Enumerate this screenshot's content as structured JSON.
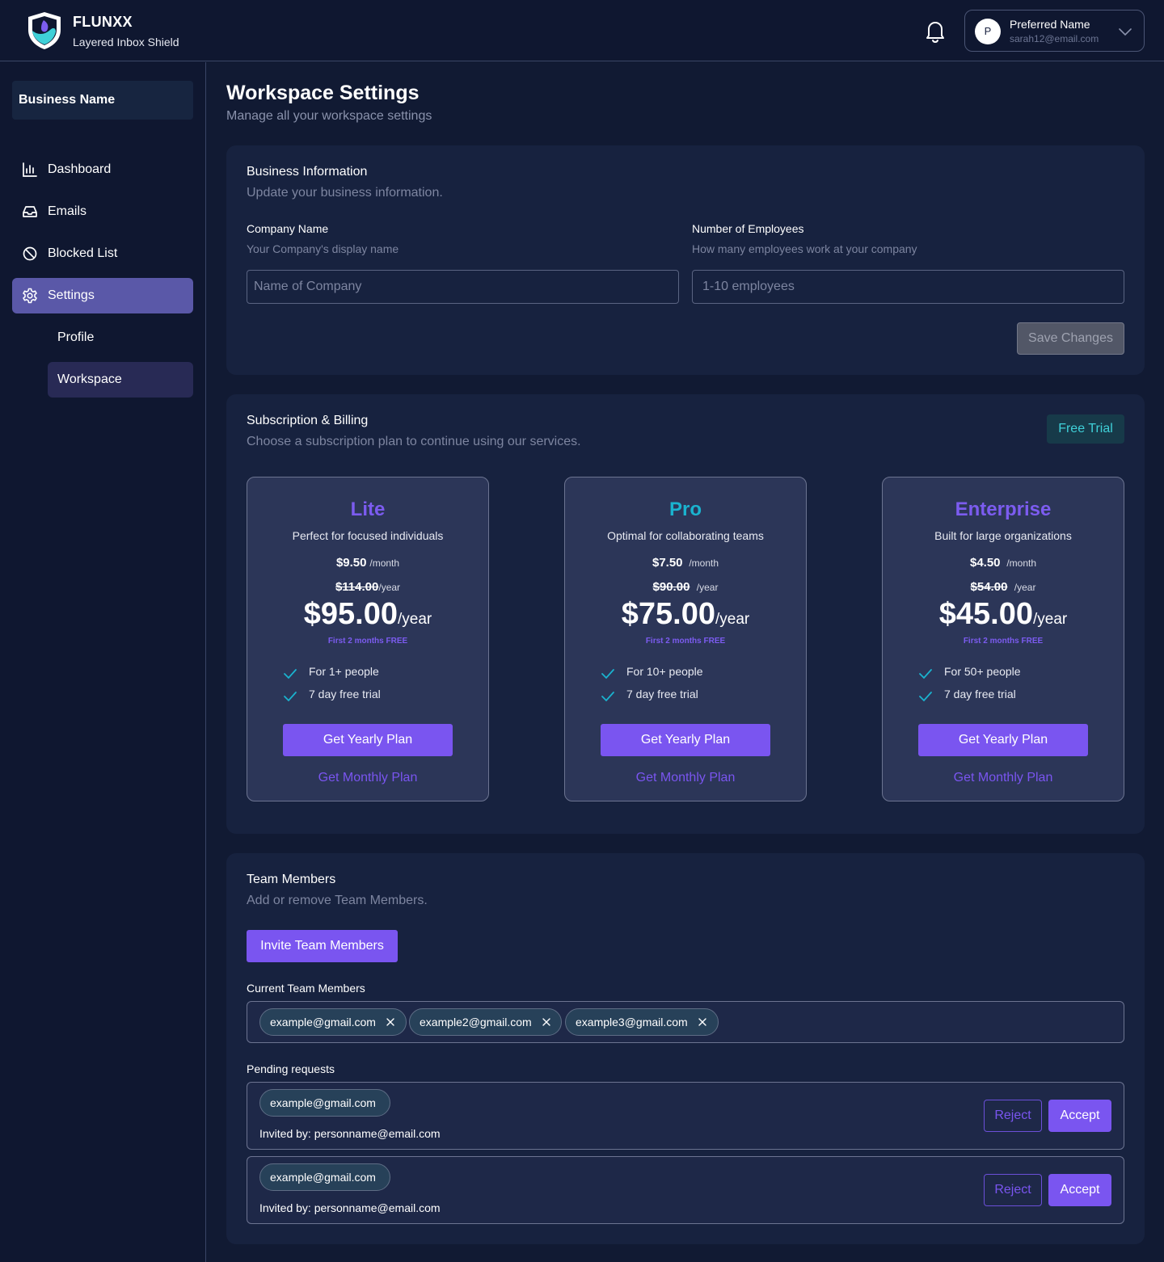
{
  "brand": {
    "name": "FLUNXX",
    "tagline": "Layered Inbox Shield"
  },
  "user": {
    "initial": "P",
    "name": "Preferred Name",
    "email": "sarah12@email.com"
  },
  "sidebar": {
    "business": "Business Name",
    "items": [
      {
        "label": "Dashboard",
        "icon": "bar-chart-icon"
      },
      {
        "label": "Emails",
        "icon": "inbox-icon"
      },
      {
        "label": "Blocked List",
        "icon": "blocked-icon"
      },
      {
        "label": "Settings",
        "icon": "gear-icon"
      }
    ],
    "sub_items": [
      {
        "label": "Profile"
      },
      {
        "label": "Workspace"
      }
    ]
  },
  "page": {
    "title": "Workspace Settings",
    "subtitle": "Manage all your workspace settings"
  },
  "business_info": {
    "title": "Business Information",
    "subtitle": "Update your business information.",
    "company_label": "Company Name",
    "company_help": "Your Company's display name",
    "company_placeholder": "Name of Company",
    "employees_label": "Number of Employees",
    "employees_help": "How many employees work at your company",
    "employees_placeholder": "1-10 employees",
    "save_label": "Save Changes"
  },
  "billing": {
    "title": "Subscription & Billing",
    "subtitle": "Choose a subscription plan to continue using our services.",
    "badge": "Free Trial",
    "plans": [
      {
        "name": "Lite",
        "color": "#7c5cf0",
        "desc": "Perfect for focused individuals",
        "monthly": "$9.50",
        "month_unit": "/month",
        "old_yearly": "$114.00",
        "year_unit_small": "/year",
        "yearly": "$95.00",
        "year_unit": "/year",
        "promo": "First 2 months FREE",
        "features": [
          "For 1+ people",
          "7 day free trial"
        ],
        "yearly_btn": "Get Yearly Plan",
        "monthly_btn": "Get Monthly Plan"
      },
      {
        "name": "Pro",
        "color": "#1ab3cf",
        "desc": "Optimal for collaborating teams",
        "monthly": "$7.50",
        "month_unit": "/month",
        "old_yearly": "$90.00",
        "year_unit_small": "/year",
        "yearly": "$75.00",
        "year_unit": "/year",
        "promo": "First 2 months FREE",
        "features": [
          "For 10+ people",
          "7 day free trial"
        ],
        "yearly_btn": "Get Yearly Plan",
        "monthly_btn": "Get Monthly Plan"
      },
      {
        "name": "Enterprise",
        "color": "#7c5cf0",
        "desc": "Built for large organizations",
        "monthly": "$4.50",
        "month_unit": "/month",
        "old_yearly": "$54.00",
        "year_unit_small": "/year",
        "yearly": "$45.00",
        "year_unit": "/year",
        "promo": "First 2 months FREE",
        "features": [
          "For 50+ people",
          "7 day free trial"
        ],
        "yearly_btn": "Get Yearly Plan",
        "monthly_btn": "Get Monthly Plan"
      }
    ]
  },
  "team": {
    "title": "Team Members",
    "subtitle": "Add or remove Team Members.",
    "invite_label": "Invite Team Members",
    "current_label": "Current Team Members",
    "members": [
      "example@gmail.com",
      "example2@gmail.com",
      "example3@gmail.com"
    ],
    "pending_label": "Pending requests",
    "pending": [
      {
        "email": "example@gmail.com",
        "invited_by": "Invited by: personname@email.com",
        "reject": "Reject",
        "accept": "Accept"
      },
      {
        "email": "example@gmail.com",
        "invited_by": "Invited by: personname@email.com",
        "reject": "Reject",
        "accept": "Accept"
      }
    ]
  },
  "colors": {
    "accent": "#7a55f0",
    "teal": "#1ab3cf",
    "background": "#111a33",
    "card": "#17223f"
  }
}
